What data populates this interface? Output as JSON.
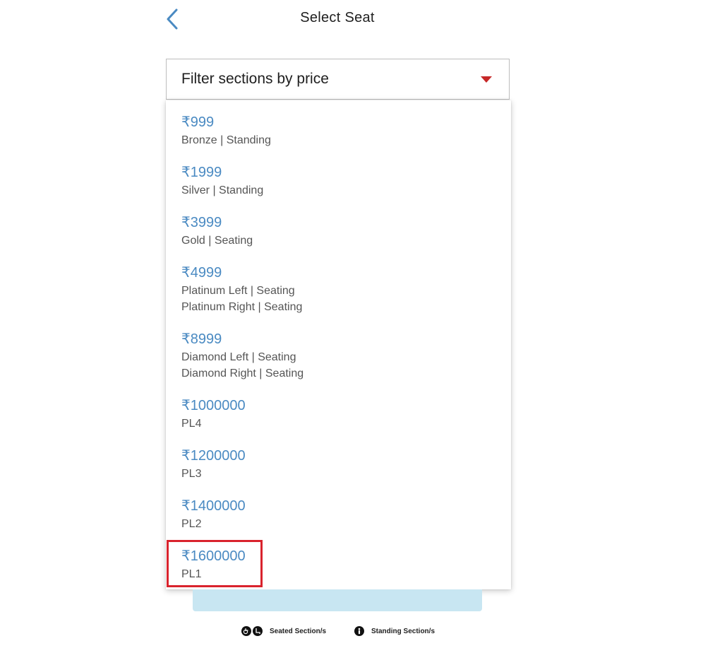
{
  "header": {
    "title": "Select Seat",
    "back_icon": "chevron-left-icon"
  },
  "filter": {
    "label": "Filter sections by price",
    "caret_icon": "caret-down-icon",
    "caret_color": "#c62828"
  },
  "price_options": [
    {
      "price": "₹999",
      "sections": [
        "Bronze | Standing"
      ]
    },
    {
      "price": "₹1999",
      "sections": [
        "Silver | Standing"
      ]
    },
    {
      "price": "₹3999",
      "sections": [
        "Gold | Seating"
      ]
    },
    {
      "price": "₹4999",
      "sections": [
        "Platinum Left | Seating",
        "Platinum Right | Seating"
      ]
    },
    {
      "price": "₹8999",
      "sections": [
        "Diamond Left | Seating",
        "Diamond Right | Seating"
      ]
    },
    {
      "price": "₹1000000",
      "sections": [
        "PL4"
      ]
    },
    {
      "price": "₹1200000",
      "sections": [
        "PL3"
      ]
    },
    {
      "price": "₹1400000",
      "sections": [
        "PL2"
      ]
    },
    {
      "price": "₹1600000",
      "sections": [
        "PL1"
      ]
    }
  ],
  "highlighted_option": "₹1600000",
  "legend": {
    "seated_label": "Seated Section/s",
    "standing_label": "Standing Section/s",
    "seated_icons": [
      "wheelchair-icon",
      "seat-icon"
    ],
    "standing_icon": "standing-person-icon"
  },
  "colors": {
    "price_text": "#4a8ac2",
    "highlight_border": "#d9232d",
    "strip_background": "#c8e6f2"
  }
}
